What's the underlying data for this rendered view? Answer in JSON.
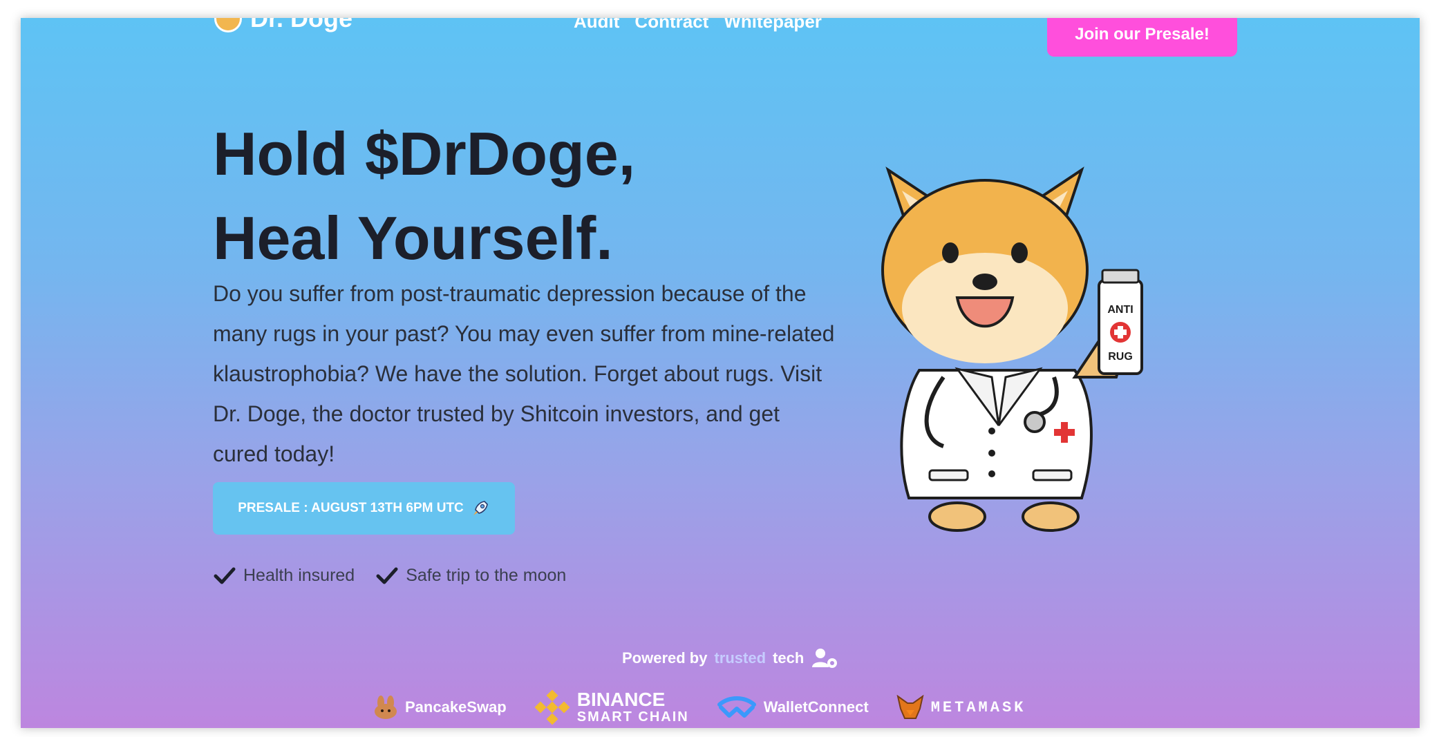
{
  "nav": {
    "logo_text": "Dr. Doge",
    "links": [
      "Audit",
      "Contract",
      "Whitepaper"
    ],
    "cta_label": "Join our Presale!"
  },
  "hero": {
    "title_line1": "Hold $DrDoge,",
    "title_line2": "Heal Yourself.",
    "description": "Do you suffer from post-traumatic depression because of the many rugs in your past? You may even suffer from mine-related klaustrophobia? We have the solution. Forget about rugs. Visit Dr. Doge, the doctor trusted by Shitcoin investors, and get cured today!",
    "presale_label": "PRESALE : AUGUST 13TH 6PM UTC",
    "features": [
      "Health insured",
      "Safe trip to the moon"
    ]
  },
  "mascot": {
    "bottle_text_1": "ANTI",
    "bottle_text_2": "RUG"
  },
  "footer": {
    "powered_prefix": "Powered by",
    "powered_brand": "trusted",
    "powered_suffix": "tech",
    "partners": {
      "pancakeswap": "PancakeSwap",
      "binance_main": "BINANCE",
      "binance_sub": "SMART CHAIN",
      "walletconnect": "WalletConnect",
      "metamask": "METAMASK"
    }
  },
  "colors": {
    "cta": "#ff4fdc",
    "presale": "#66c3f0",
    "heading": "#1c1f2a",
    "gradient_top": "#5ec3f4",
    "gradient_bottom": "#bd86df"
  }
}
